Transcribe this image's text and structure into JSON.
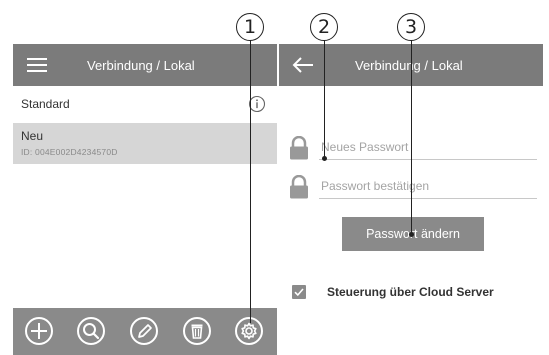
{
  "callouts": [
    "1",
    "2",
    "3"
  ],
  "left_screen": {
    "title": "Verbindung / Lokal",
    "menu_icon": "hamburger-menu-icon",
    "items": [
      {
        "name": "Standard",
        "info_icon": "info-icon",
        "selected": false
      },
      {
        "name": "Neu",
        "id": "ID: 004E002D4234570D",
        "selected": true
      }
    ],
    "toolbar_icons": [
      "add-icon",
      "search-icon",
      "edit-icon",
      "delete-icon",
      "settings-icon"
    ]
  },
  "right_screen": {
    "title": "Verbindung / Lokal",
    "back_icon": "back-arrow-icon",
    "new_password_placeholder": "Neues Passwort",
    "confirm_password_placeholder": "Passwort bestätigen",
    "change_password_button": "Passwort ändern",
    "cloud_checkbox_label": "Steuerung über Cloud Server",
    "cloud_checkbox_checked": true
  },
  "colors": {
    "bar": "#7b7b7b",
    "selected_row": "#d6d6d6",
    "button": "#8a8a8a"
  }
}
